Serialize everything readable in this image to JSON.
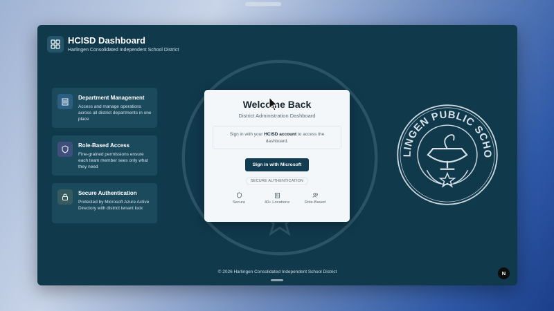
{
  "header": {
    "title": "HCISD Dashboard",
    "subtitle": "Harlingen Consolidated Independent School District",
    "icon": "grid-icon"
  },
  "features": [
    {
      "title": "Department Management",
      "description": "Access and manage operations across all district departments in one place",
      "icon": "building-icon",
      "color": "#2a5f82"
    },
    {
      "title": "Role-Based Access",
      "description": "Fine-grained permissions ensure each team member sees only what they need",
      "icon": "shield-icon",
      "color": "#3f4f7c"
    },
    {
      "title": "Secure Authentication",
      "description": "Protected by Microsoft Azure Active Directory with district tenant lock",
      "icon": "lock-icon",
      "color": "#355b5e"
    }
  ],
  "login": {
    "title": "Welcome Back",
    "subtitle": "District Administration Dashboard",
    "notice_prefix": "Sign in with your ",
    "notice_bold": "HCISD account",
    "notice_suffix": " to access the dashboard.",
    "button": "Sign in with Microsoft",
    "secure_tag": "SECURE AUTHENTICATION",
    "features": [
      {
        "label": "Secure",
        "icon": "shield-icon"
      },
      {
        "label": "40+ Locations",
        "icon": "building-icon"
      },
      {
        "label": "Role-Based",
        "icon": "users-icon"
      }
    ]
  },
  "seal": {
    "text": "HARLINGEN PUBLIC SCHOOLS"
  },
  "footer": "© 2026 Harlingen Consolidated Independent School District",
  "badge": "N",
  "colors": {
    "window_bg": "#10394c",
    "card_bg": "#f4f7fa",
    "button_bg": "#123c52"
  }
}
